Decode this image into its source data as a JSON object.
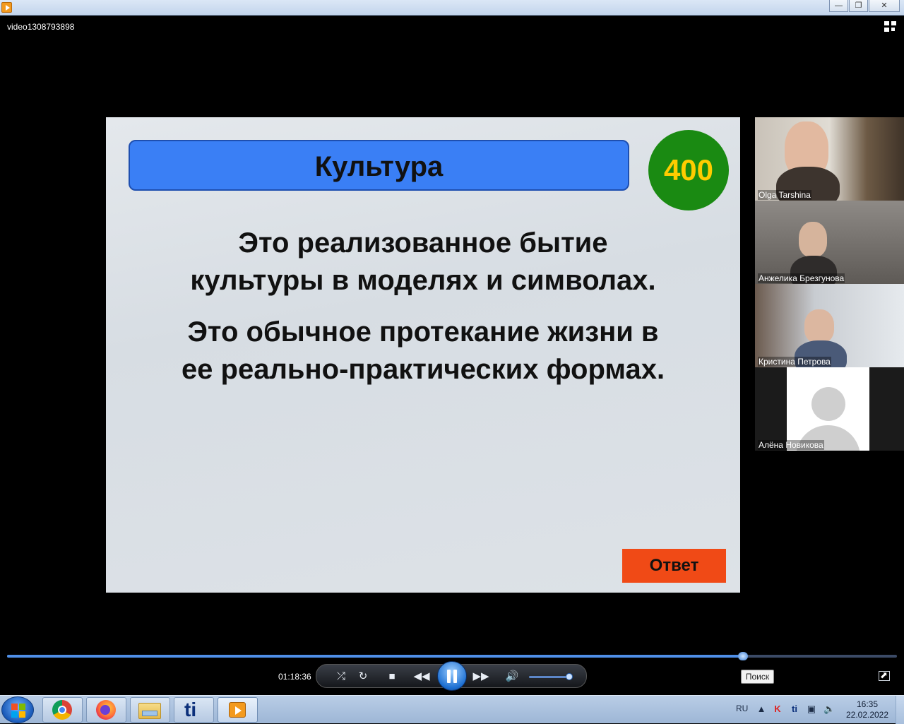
{
  "window": {
    "icon": "media-player-icon",
    "minimize_glyph": "—",
    "restore_glyph": "❐",
    "close_glyph": "✕"
  },
  "video": {
    "title": "video1308793898"
  },
  "slide": {
    "header": "Культура",
    "points": "400",
    "line1": "Это реализованное бытие",
    "line2": "культуры в моделях и символах.",
    "line3": "Это обычное протекание жизни в",
    "line4": "ее реально-практических формах.",
    "answer_button": "Ответ",
    "colors": {
      "header": "#3a7ff5",
      "points_circle": "#1a8a12",
      "points_text": "#ffcc00",
      "answer": "#f04a16"
    }
  },
  "participants": [
    {
      "name": "Olga Tarshina"
    },
    {
      "name": "Анжелика  Брезгунова"
    },
    {
      "name": "Кристина Петрова"
    },
    {
      "name": "Алёна Новикова"
    }
  ],
  "playback": {
    "elapsed": "01:18:36",
    "progress_fraction": 0.827,
    "volume_fraction": 0.98,
    "icons": [
      "shuffle-icon",
      "repeat-icon",
      "stop-icon",
      "rewind-icon",
      "pause-icon",
      "fast-forward-icon",
      "volume-icon"
    ],
    "search_button": "Поиск"
  },
  "taskbar": {
    "apps": [
      "chrome-icon",
      "firefox-icon",
      "file-explorer-icon",
      "ti-app-icon",
      "media-player-icon"
    ],
    "language": "RU",
    "time": "16:35",
    "date": "22.02.2022"
  }
}
